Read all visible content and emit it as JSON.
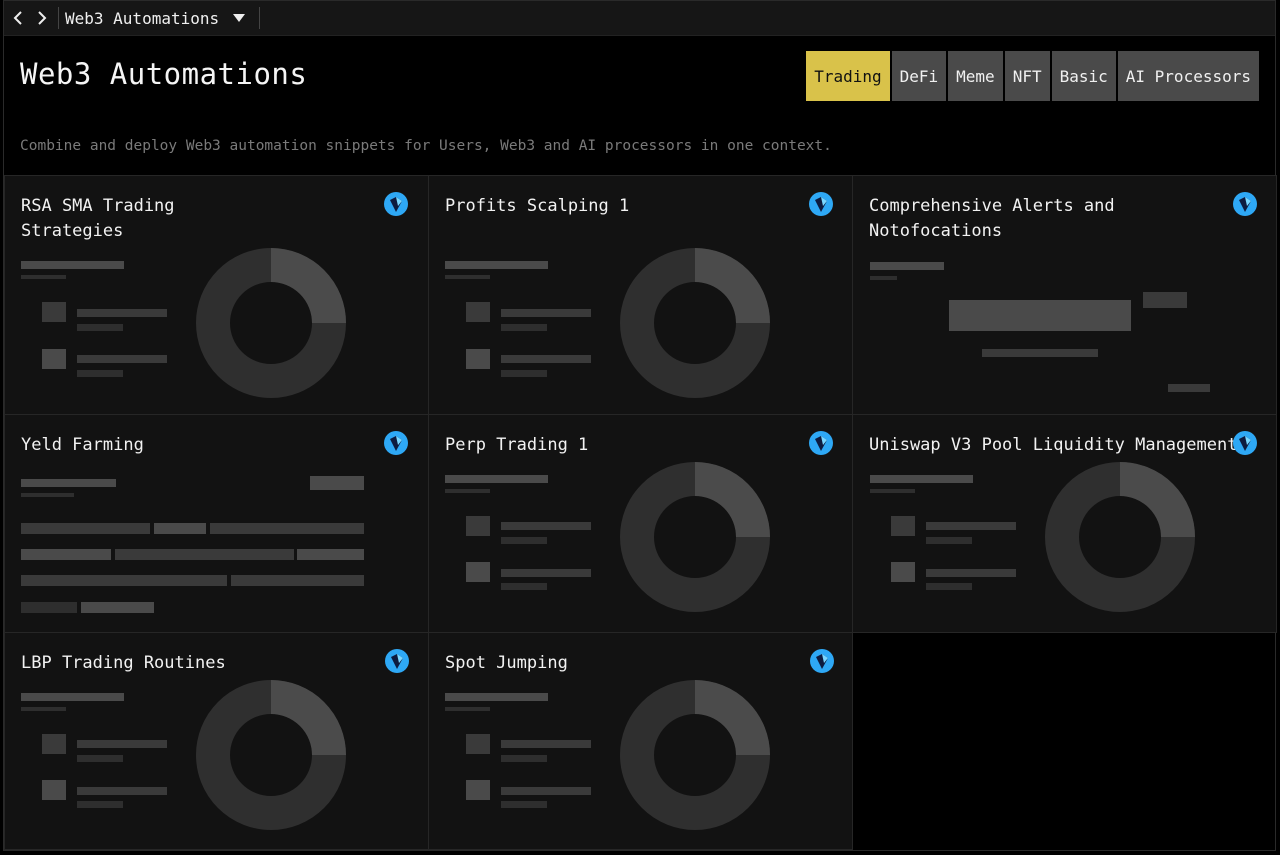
{
  "topbar": {
    "back_icon": "chevron-left-icon",
    "forward_icon": "chevron-right-icon",
    "breadcrumb": "Web3 Automations",
    "dropdown_icon": "caret-down-icon"
  },
  "header": {
    "title": "Web3 Automations",
    "subtitle": "Combine and deploy Web3 automation snippets for Users, Web3 and AI processors in one context."
  },
  "tabs": [
    {
      "label": "Trading",
      "active": true
    },
    {
      "label": "DeFi",
      "active": false
    },
    {
      "label": "Meme",
      "active": false
    },
    {
      "label": "NFT",
      "active": false
    },
    {
      "label": "Basic",
      "active": false
    },
    {
      "label": "AI Processors",
      "active": false
    }
  ],
  "colors": {
    "accent": "#d9c24a",
    "tab_bg": "#4a4a4a",
    "card_bg": "#121212",
    "logo_blue": "#2ea8f5"
  },
  "cards": [
    {
      "title": "RSA SMA Trading Strategies",
      "icon": "web3-logo-icon",
      "preview": "donut"
    },
    {
      "title": "Profits Scalping 1",
      "icon": "web3-logo-icon",
      "preview": "donut"
    },
    {
      "title": "Comprehensive Alerts and Notofocations",
      "icon": "web3-logo-icon",
      "preview": "bars"
    },
    {
      "title": "Yeld Farming",
      "icon": "web3-logo-icon",
      "preview": "table"
    },
    {
      "title": "Perp Trading 1",
      "icon": "web3-logo-icon",
      "preview": "donut"
    },
    {
      "title": "Uniswap V3 Pool Liquidity Management",
      "icon": "web3-logo-icon",
      "preview": "donut"
    },
    {
      "title": "LBP Trading Routines",
      "icon": "web3-logo-icon",
      "preview": "donut"
    },
    {
      "title": "Spot Jumping",
      "icon": "web3-logo-icon",
      "preview": "donut"
    }
  ]
}
